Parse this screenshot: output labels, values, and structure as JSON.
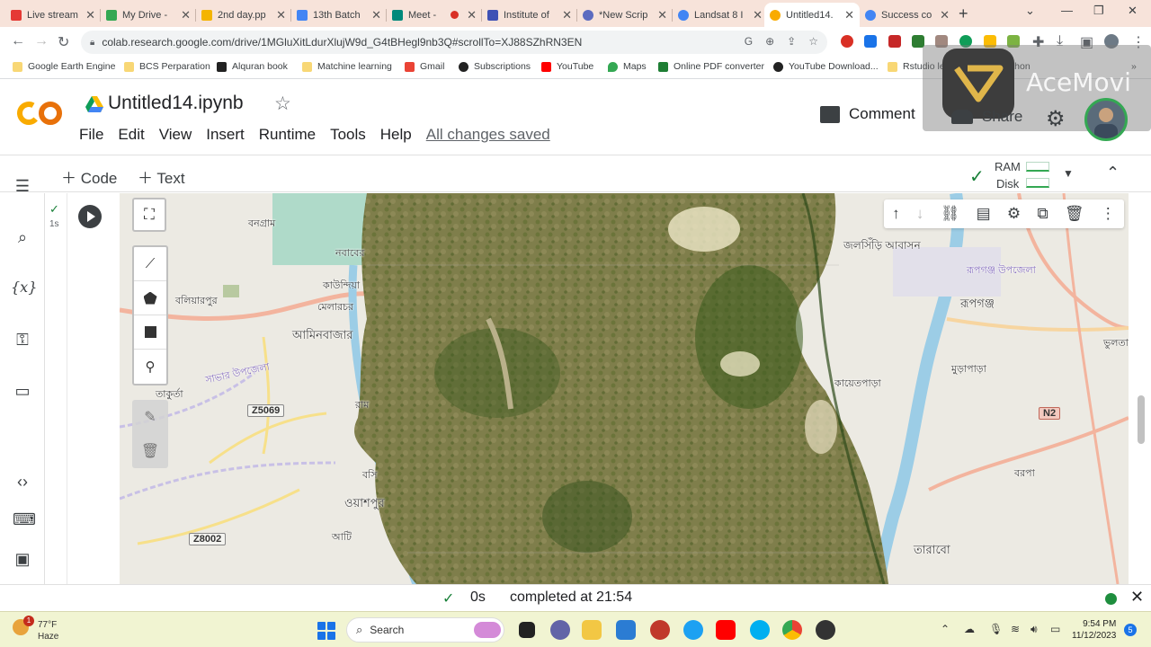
{
  "browser": {
    "tabs": [
      {
        "title": "Live stream",
        "color": "#e53935"
      },
      {
        "title": "My Drive -",
        "color": "#34a853"
      },
      {
        "title": "2nd day.pp",
        "color": "#f4b400"
      },
      {
        "title": "13th Batch",
        "color": "#4285f4"
      },
      {
        "title": "Meet -",
        "color": "#00897b"
      },
      {
        "title": "Institute of",
        "color": "#3f51b5"
      },
      {
        "title": "*New Scrip",
        "color": "#5c6bc0"
      },
      {
        "title": "Landsat 8 I",
        "color": "#4285f4"
      },
      {
        "title": "Untitled14.",
        "color": "#f9ab00"
      },
      {
        "title": "Success co",
        "color": "#4285f4"
      }
    ],
    "new_tab": "+",
    "url": "colab.research.google.com/drive/1MGluXitLdurXlujW9d_G4tBHegl9nb3Q#scrollTo=XJ88SZhRN3EN",
    "bookmarks": [
      {
        "label": "Google Earth Engine",
        "kind": "folder"
      },
      {
        "label": "BCS Perparation",
        "kind": "folder"
      },
      {
        "label": "Alquran book",
        "kind": "site"
      },
      {
        "label": "Matchine learning",
        "kind": "folder"
      },
      {
        "label": "Gmail",
        "kind": "gmail"
      },
      {
        "label": "Subscriptions",
        "kind": "site"
      },
      {
        "label": "YouTube",
        "kind": "youtube"
      },
      {
        "label": "Maps",
        "kind": "maps"
      },
      {
        "label": "Online PDF converter",
        "kind": "site"
      },
      {
        "label": "YouTube Download...",
        "kind": "site"
      },
      {
        "label": "Rstudio learning",
        "kind": "folder"
      },
      {
        "label": "Python",
        "kind": "folder"
      }
    ]
  },
  "colab": {
    "notebook_title": "Untitled14.ipynb",
    "menu": [
      "File",
      "Edit",
      "View",
      "Insert",
      "Runtime",
      "Tools",
      "Help"
    ],
    "saved_status": "All changes saved",
    "comment_label": "Comment",
    "share_label": "Share",
    "add_code": "Code",
    "add_text": "Text",
    "ram_label": "RAM",
    "disk_label": "Disk",
    "exec_time": "1s",
    "status_seconds": "0s",
    "status_text": "completed at 21:54"
  },
  "watermark": {
    "text": "AceMovi"
  },
  "map": {
    "labels": [
      {
        "text": "বনগ্রাম"
      },
      {
        "text": "নবাবের"
      },
      {
        "text": "কাউন্দিয়া"
      },
      {
        "text": "বলিয়ারপুর"
      },
      {
        "text": "মেলারচর"
      },
      {
        "text": "আমিনবাজার"
      },
      {
        "text": "সাভার উপজেলা"
      },
      {
        "text": "তাকুর্তা"
      },
      {
        "text": "রাম"
      },
      {
        "text": "বসি"
      },
      {
        "text": "ওয়াশপুর"
      },
      {
        "text": "আটি"
      },
      {
        "text": "জলসিঁড়ি আবাসন"
      },
      {
        "text": "রূপগঞ্জ উপজেলা"
      },
      {
        "text": "রূপগঞ্জ"
      },
      {
        "text": "ভুলতা"
      },
      {
        "text": "কায়েতপাড়া"
      },
      {
        "text": "মুড়াপাড়া"
      },
      {
        "text": "বরপা"
      },
      {
        "text": "তারাবো"
      }
    ],
    "road_tags": [
      "Z5069",
      "Z8002",
      "N2"
    ]
  },
  "taskbar": {
    "temperature": "77°F",
    "weather": "Haze",
    "weather_badge": "1",
    "search": "Search",
    "time": "9:54 PM",
    "date": "11/12/2023",
    "notifications": "5"
  }
}
